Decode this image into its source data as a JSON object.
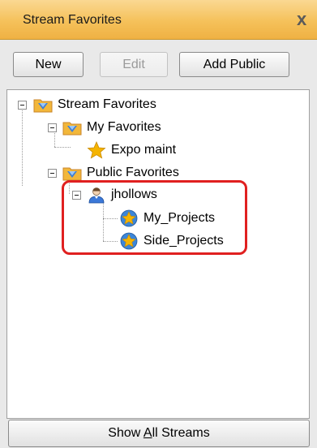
{
  "panel": {
    "title": "Stream Favorites",
    "close_glyph": "x"
  },
  "toolbar": {
    "new_label": "New",
    "edit_label": "Edit",
    "add_public_label": "Add Public"
  },
  "tree": {
    "root": {
      "label": "Stream Favorites",
      "icon": "folder-stream-icon",
      "expanded": true
    },
    "my_favorites": {
      "label": "My Favorites",
      "icon": "folder-stream-icon",
      "expanded": true,
      "items": [
        {
          "label": "Expo maint",
          "icon": "star-icon"
        }
      ]
    },
    "public_favorites": {
      "label": "Public Favorites",
      "icon": "folder-stream-icon",
      "expanded": true,
      "user": {
        "label": "jhollows",
        "icon": "user-icon",
        "expanded": true,
        "items": [
          {
            "label": "My_Projects",
            "icon": "star-badge-icon"
          },
          {
            "label": "Side_Projects",
            "icon": "star-badge-icon"
          }
        ]
      }
    }
  },
  "footer": {
    "show_all_prefix": "Show ",
    "show_all_mnemonic": "A",
    "show_all_suffix": "ll Streams"
  },
  "colors": {
    "titlebar": "#f5c15a",
    "highlight": "#e02020",
    "folder": "#f2b73a",
    "star": "#f5b400"
  }
}
